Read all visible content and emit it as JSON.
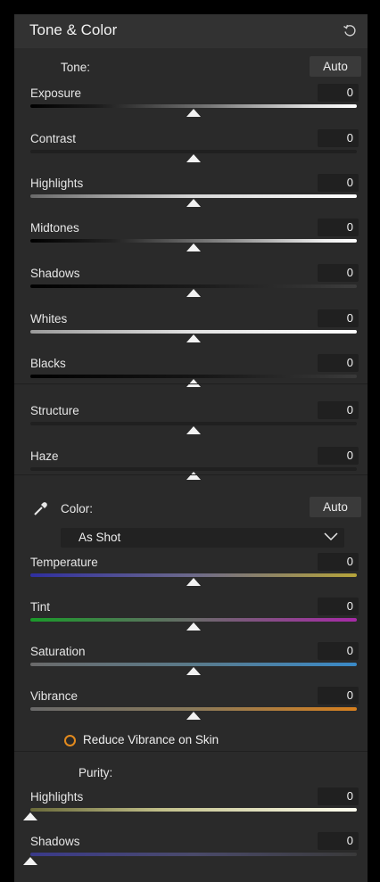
{
  "panel": {
    "title": "Tone & Color"
  },
  "tone": {
    "label": "Tone:",
    "auto_label": "Auto",
    "sliders": [
      {
        "label": "Exposure",
        "value": "0",
        "position": 0.5,
        "track": "linear-gradient(to right,#000 0%,#1a1a1a 20%,#777 55%,#ddd 85%,#fff 100%)"
      },
      {
        "label": "Contrast",
        "value": "0",
        "position": 0.5,
        "track": "#202020"
      },
      {
        "label": "Highlights",
        "value": "0",
        "position": 0.5,
        "track": "linear-gradient(to right,#6a6a6a 0%,#d6d6d6 50%,#fff 100%)"
      },
      {
        "label": "Midtones",
        "value": "0",
        "position": 0.5,
        "track": "linear-gradient(to right,#000 0%,#222 25%,#888 60%,#eee 90%,#fff 100%)"
      },
      {
        "label": "Shadows",
        "value": "0",
        "position": 0.5,
        "track": "linear-gradient(to right,#000 0%,#1a1a1a 50%,#3c3c3c 100%)"
      },
      {
        "label": "Whites",
        "value": "0",
        "position": 0.5,
        "track": "linear-gradient(to right,#9a9a9a 0%,#e2e2e2 50%,#fff 100%)"
      },
      {
        "label": "Blacks",
        "value": "0",
        "position": 0.5,
        "track": "linear-gradient(to right,#000 0%,#141414 50%,#3a3a3a 100%)"
      },
      {
        "label": "Structure",
        "value": "0",
        "position": 0.5,
        "track": "#202020"
      },
      {
        "label": "Haze",
        "value": "0",
        "position": 0.5,
        "track": "#202020"
      }
    ]
  },
  "color": {
    "label": "Color:",
    "auto_label": "Auto",
    "preset": "As Shot",
    "sliders": [
      {
        "label": "Temperature",
        "value": "0",
        "position": 0.5,
        "track": "linear-gradient(to right,#2f2fa0 0%,#6d6a8a 50%,#b6a43a 100%)"
      },
      {
        "label": "Tint",
        "value": "0",
        "position": 0.5,
        "track": "linear-gradient(to right,#1a9a2a 0%,#6a6a6a 50%,#a82aa8 100%)"
      },
      {
        "label": "Saturation",
        "value": "0",
        "position": 0.5,
        "track": "linear-gradient(to right,#6a6a6a 0%,#5a7a8a 50%,#3a8ac8 100%)"
      },
      {
        "label": "Vibrance",
        "value": "0",
        "position": 0.5,
        "track": "linear-gradient(to right,#6a6a6a 0%,#8a7a5a 50%,#d8801e 100%)"
      }
    ],
    "reduce_vibrance_label": "Reduce Vibrance on Skin"
  },
  "purity": {
    "label": "Purity:",
    "sliders": [
      {
        "label": "Highlights",
        "value": "0",
        "position": 0.0,
        "track": "linear-gradient(to right,#6a6a3a 0%,#c2c08a 40%,#fffff0 100%)"
      },
      {
        "label": "Shadows",
        "value": "0",
        "position": 0.0,
        "track": "linear-gradient(to right,#3a3a8a 0%,#4a4a6a 50%,#3a3a3a 100%)"
      }
    ]
  },
  "colors": {
    "accent_orange": "#e28a1e",
    "panel_bg": "#2a2a2a",
    "header_bg": "#323232"
  }
}
